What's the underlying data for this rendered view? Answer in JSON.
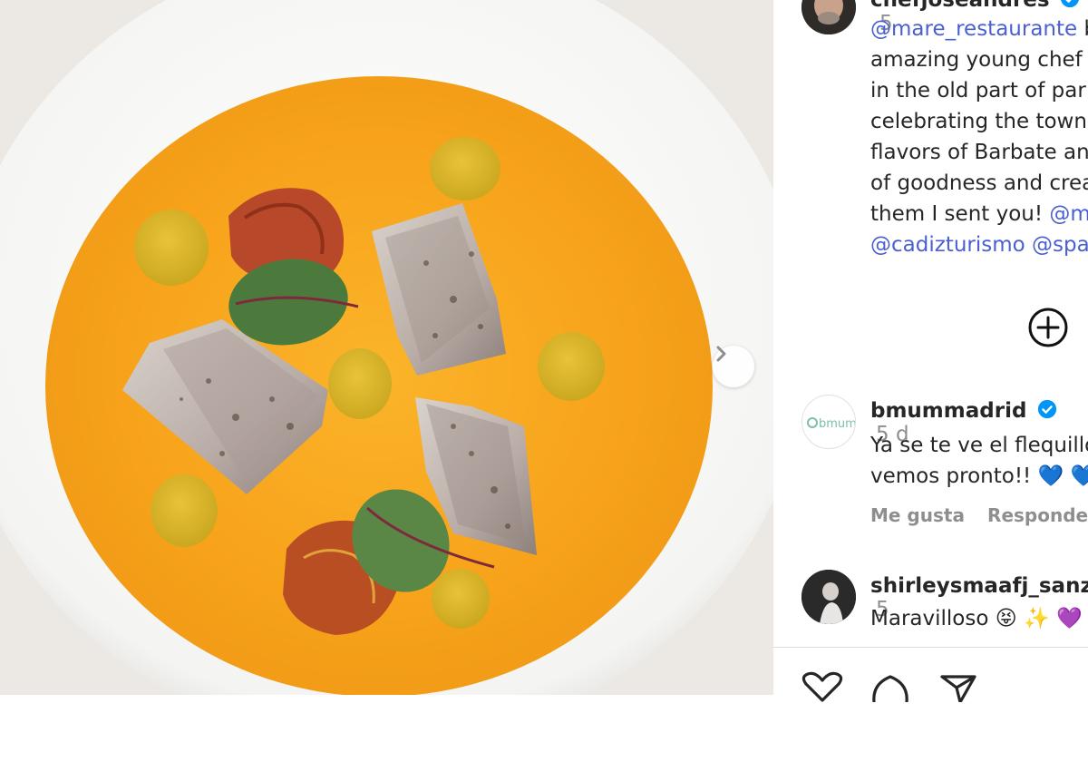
{
  "post": {
    "author": {
      "username": "chefjoseandres",
      "time": "5",
      "verified": true
    },
    "caption_lines": [
      [
        {
          "text": "@mare_restaurante",
          "mention": true
        },
        {
          "text": " b",
          "mention": false
        }
      ],
      [
        {
          "text": "amazing young chef",
          "mention": false
        }
      ],
      [
        {
          "text": "in the old part of par",
          "mention": false
        }
      ],
      [
        {
          "text": "celebrating the town",
          "mention": false
        }
      ],
      [
        {
          "text": "flavors of Barbate an",
          "mention": false
        }
      ],
      [
        {
          "text": "of goodness and crea",
          "mention": false
        }
      ],
      [
        {
          "text": "them I sent you! ",
          "mention": false
        },
        {
          "text": "@m",
          "mention": true
        }
      ],
      [
        {
          "text": "@cadizturismo",
          "mention": true
        },
        {
          "text": " ",
          "mention": false
        },
        {
          "text": "@spa",
          "mention": true
        }
      ]
    ]
  },
  "media": {
    "carousel_next_icon": "chevron-right-icon"
  },
  "comments": [
    {
      "username": "bmummadrid",
      "verified": true,
      "time": "5 d",
      "avatar_text": "bmum",
      "lines": [
        "Ya se te ve el flequillo",
        "vemos pronto!! 💙 💙"
      ],
      "like_label": "Me gusta",
      "reply_label": "Responder"
    },
    {
      "username": "shirleysmaafj_sanz",
      "verified": false,
      "time": "5",
      "lines": [
        "Maravilloso 😝 ✨ 💜"
      ]
    }
  ],
  "actions": {
    "add_icon": "plus-circle-icon",
    "like_icon": "heart-icon",
    "comment_icon": "comment-icon",
    "share_icon": "send-icon"
  },
  "colors": {
    "mention": "#4a5fd0",
    "verified": "#0095f6",
    "muted": "#8e8e8e",
    "soup": "#f5a623"
  }
}
